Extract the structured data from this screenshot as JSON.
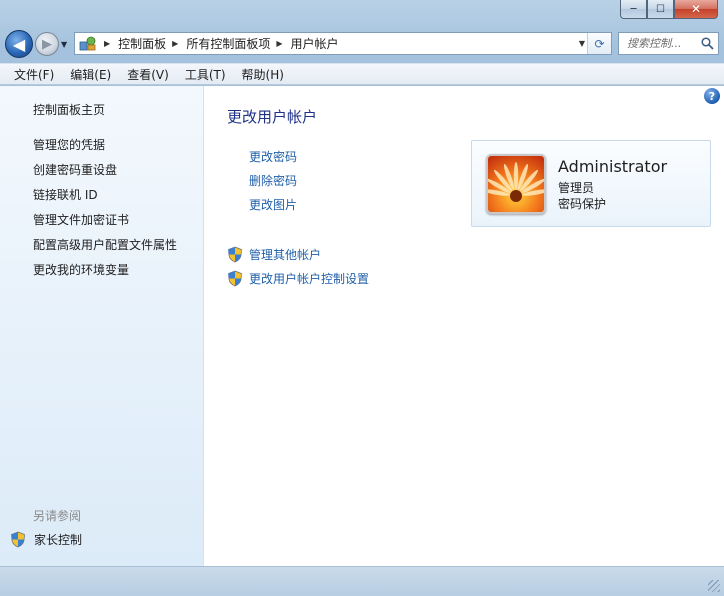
{
  "window": {
    "caption_buttons": {
      "minimize": "─",
      "maximize": "☐",
      "close": "✕"
    }
  },
  "nav": {
    "back_glyph": "◀",
    "forward_glyph": "▶",
    "breadcrumbs": [
      "控制面板",
      "所有控制面板项",
      "用户帐户"
    ],
    "search_placeholder": "搜索控制..."
  },
  "menu": {
    "items": [
      "文件(F)",
      "编辑(E)",
      "查看(V)",
      "工具(T)",
      "帮助(H)"
    ]
  },
  "sidebar": {
    "links": [
      "控制面板主页",
      "管理您的凭据",
      "创建密码重设盘",
      "链接联机 ID",
      "管理文件加密证书",
      "配置高级用户配置文件属性",
      "更改我的环境变量"
    ],
    "see_also_label": "另请参阅",
    "parental_controls_label": "家长控制"
  },
  "main": {
    "title": "更改用户帐户",
    "tasks": [
      "更改密码",
      "删除密码",
      "更改图片"
    ],
    "admin_tasks": [
      "管理其他帐户",
      "更改用户帐户控制设置"
    ],
    "help_glyph": "?"
  },
  "account": {
    "name": "Administrator",
    "role": "管理员",
    "password_status": "密码保护"
  },
  "colors": {
    "link": "#1f5fa8",
    "title": "#1e3287",
    "sidebar_bg": "#e6f1fb"
  }
}
